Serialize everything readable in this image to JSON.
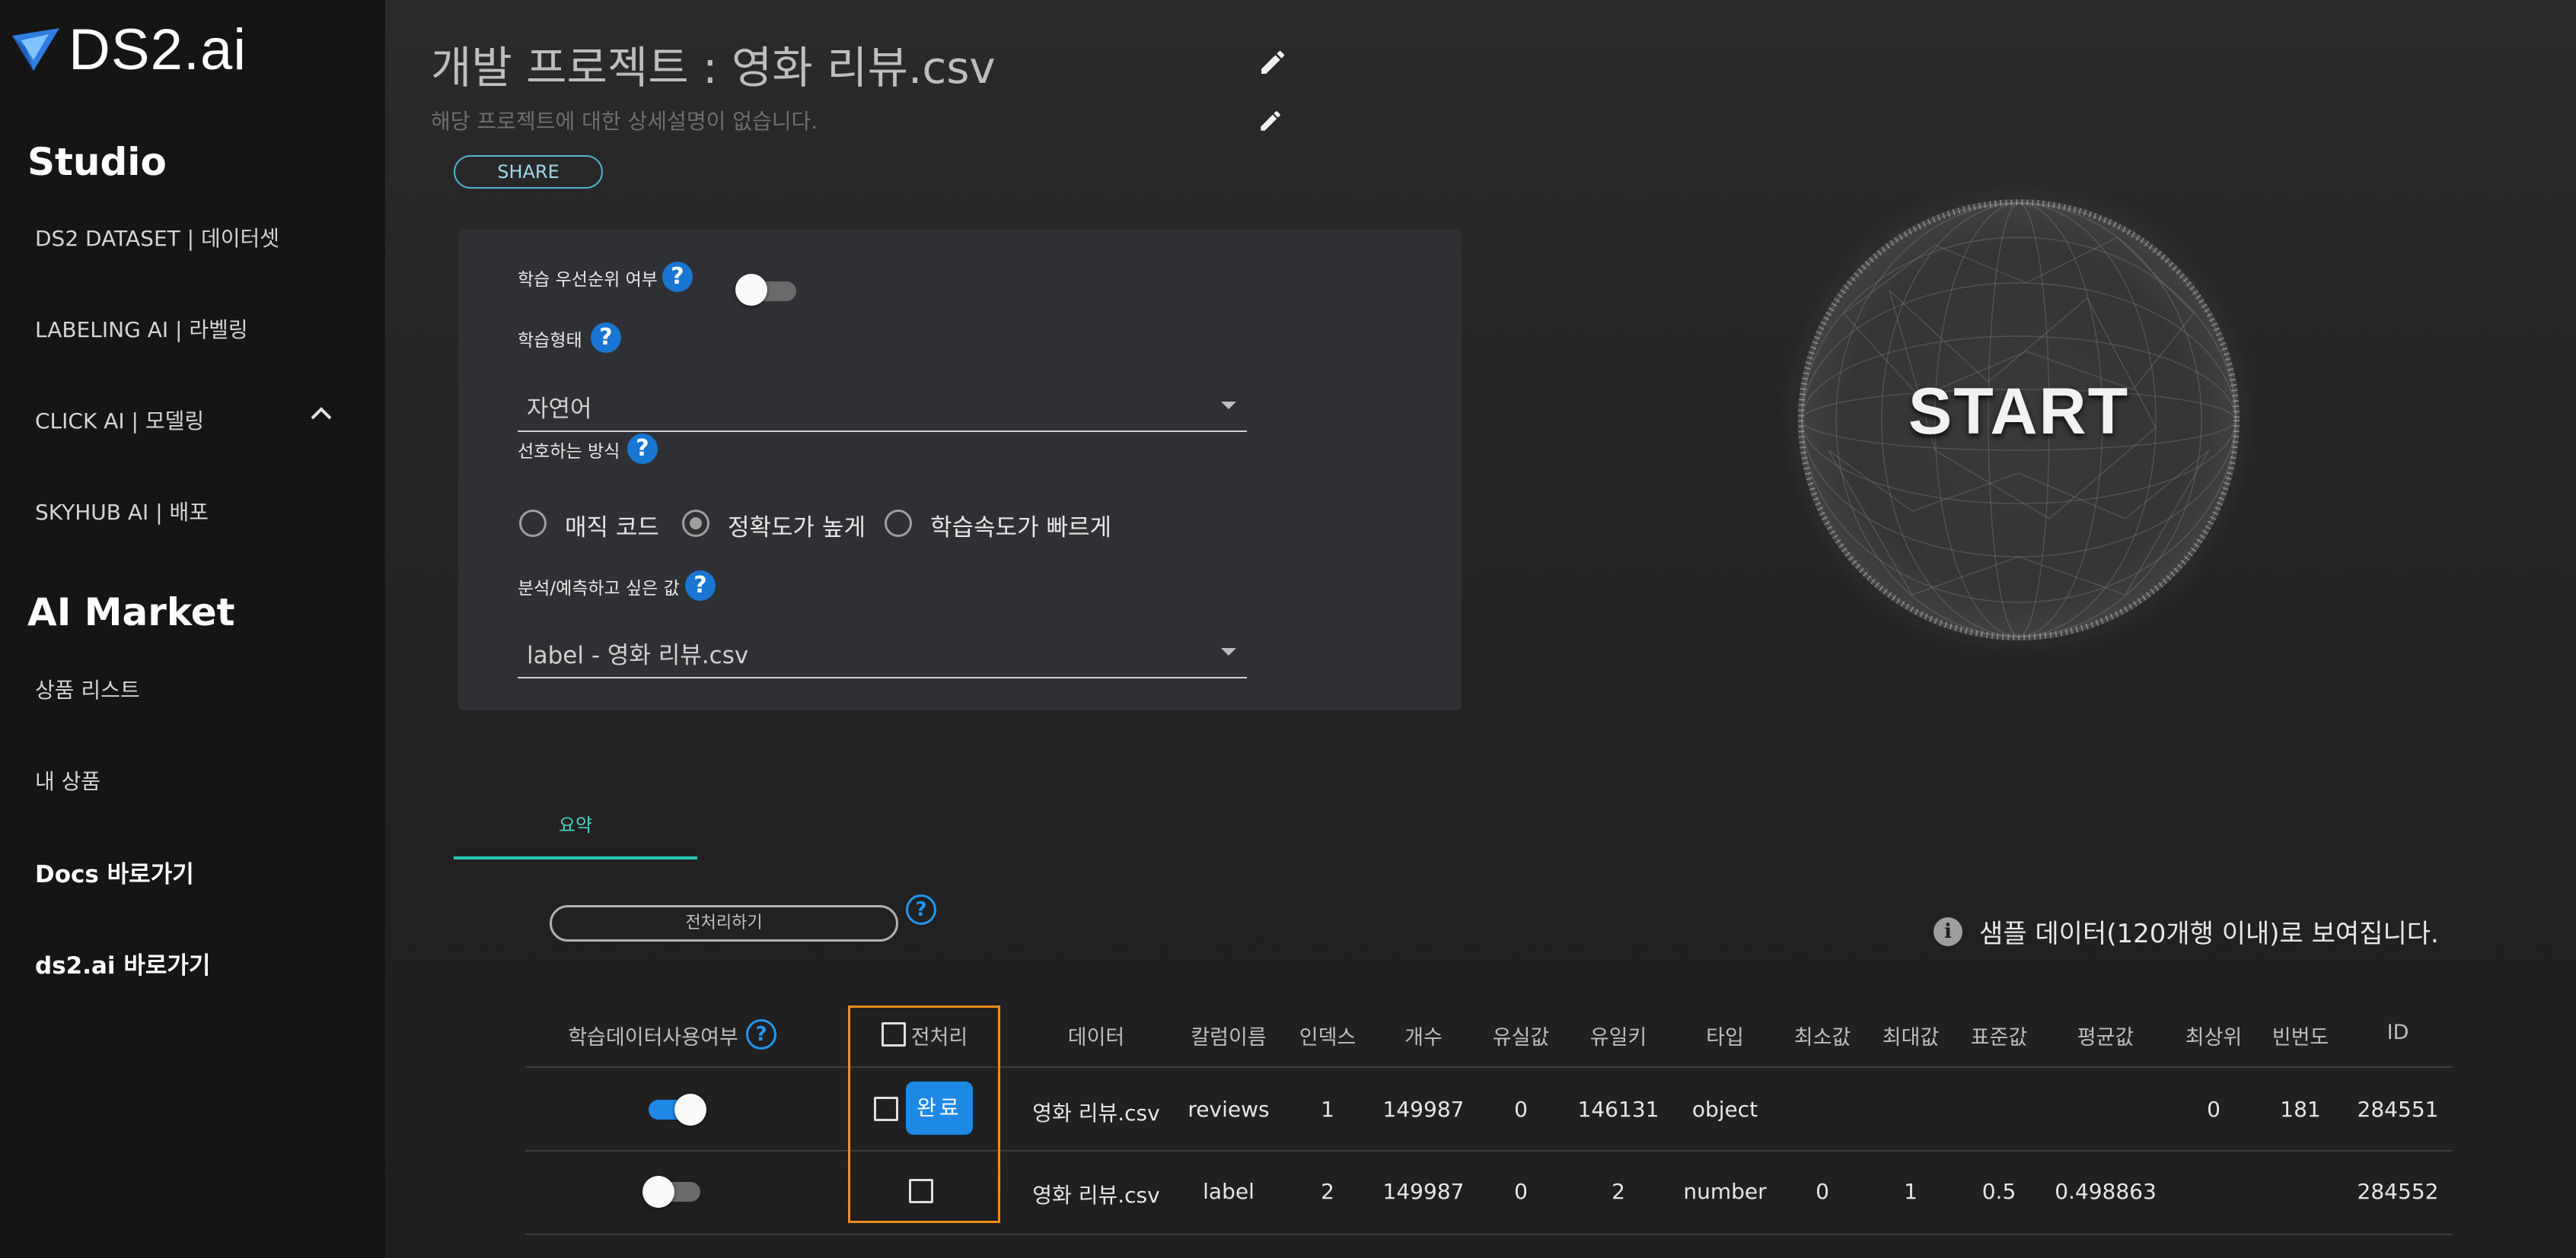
{
  "brand": {
    "name": "DS2.ai"
  },
  "sidebar": {
    "studio_heading": "Studio",
    "studio_items": [
      {
        "label": "DS2 DATASET | 데이터셋"
      },
      {
        "label": "LABELING AI | 라벨링"
      },
      {
        "label": "CLICK AI | 모델링"
      },
      {
        "label": "SKYHUB AI | 배포"
      }
    ],
    "market_heading": "AI Market",
    "market_items": [
      {
        "label": "상품 리스트"
      },
      {
        "label": "내 상품"
      }
    ],
    "links": [
      {
        "label": "Docs 바로가기"
      },
      {
        "label": "ds2.ai 바로가기"
      }
    ]
  },
  "project": {
    "title": "개발 프로젝트 : 영화 리뷰.csv",
    "description": "해당 프로젝트에 대한 상세설명이 없습니다.",
    "share_label": "SHARE"
  },
  "settings": {
    "priority_label": "학습 우선순위 여부",
    "priority_on": false,
    "train_type_label": "학습형태",
    "train_type_value": "자연어",
    "method_label": "선호하는 방식",
    "methods": [
      {
        "label": "매직 코드",
        "selected": false
      },
      {
        "label": "정확도가 높게",
        "selected": true
      },
      {
        "label": "학습속도가 빠르게",
        "selected": false
      }
    ],
    "target_label": "분석/예측하고 싶은 값",
    "target_value": "label - 영화 리뷰.csv"
  },
  "start_label": "START",
  "tabs": [
    {
      "label": "요약",
      "active": true
    }
  ],
  "preprocess_button": "전처리하기",
  "sample_notice": "샘플 데이터(120개행 이내)로 보여집니다.",
  "table": {
    "headers": {
      "use": "학습데이터사용여부",
      "preprocess": "전처리",
      "data": "데이터",
      "column": "칼럼이름",
      "index": "인덱스",
      "count": "개수",
      "missing": "유실값",
      "unique": "유일키",
      "type": "타입",
      "min": "최소값",
      "max": "최대값",
      "std": "표준값",
      "mean": "평균값",
      "top": "최상위",
      "freq": "빈번도",
      "id": "ID"
    },
    "done_label": "완료",
    "rows": [
      {
        "use": true,
        "data": "영화 리뷰.csv",
        "column": "reviews",
        "index": "1",
        "count": "149987",
        "missing": "0",
        "unique": "146131",
        "type": "object",
        "min": "",
        "max": "",
        "std": "",
        "mean": "",
        "top": "0",
        "freq": "181",
        "id": "284551"
      },
      {
        "use": false,
        "data": "영화 리뷰.csv",
        "column": "label",
        "index": "2",
        "count": "149987",
        "missing": "0",
        "unique": "2",
        "type": "number",
        "min": "0",
        "max": "1",
        "std": "0.5",
        "mean": "0.498863",
        "top": "",
        "freq": "",
        "id": "284552"
      }
    ]
  },
  "colors": {
    "accent": "#1e88e5",
    "teal": "#26c6b4",
    "highlight": "#f28a1f"
  }
}
